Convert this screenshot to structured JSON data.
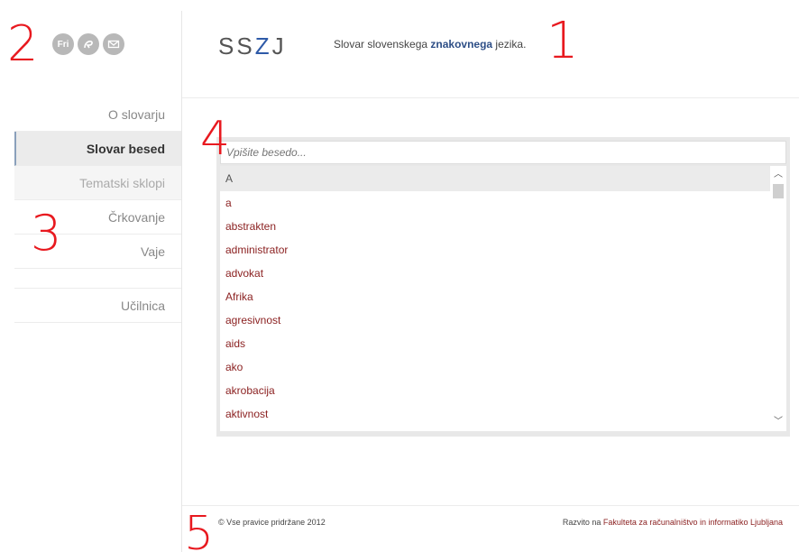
{
  "annotations": [
    "1",
    "2",
    "3",
    "4",
    "5"
  ],
  "header": {
    "logo_prefix": "SS",
    "logo_z": "Z",
    "logo_suffix": "J",
    "tagline_pre": "Slovar slovenskega ",
    "tagline_bold": "znakovnega",
    "tagline_post": " jezika."
  },
  "social_icons": [
    {
      "name": "fri-icon",
      "label": "Fri"
    },
    {
      "name": "sign-language-icon"
    },
    {
      "name": "mail-icon"
    }
  ],
  "nav": {
    "items": [
      {
        "label": "O slovarju"
      },
      {
        "label": "Slovar besed",
        "state": "active"
      },
      {
        "label": "Tematski sklopi"
      },
      {
        "label": "Črkovanje"
      },
      {
        "label": "Vaje"
      },
      {
        "label": "Učilnica"
      }
    ]
  },
  "dictionary": {
    "search_placeholder": "Vpišite besedo...",
    "letter": "A",
    "words": [
      "a",
      "abstrakten",
      "administrator",
      "advokat",
      "Afrika",
      "agresivnost",
      "aids",
      "ako",
      "akrobacija",
      "aktivnost"
    ]
  },
  "footer": {
    "copyright": "© Vse pravice pridržane 2012",
    "developed_pre": "Razvito na ",
    "developed_link": "Fakulteta za računalništvo in informatiko Ljubljana"
  },
  "colors": {
    "accent_blue": "#2e5aa8",
    "word_red": "#8a1f1f",
    "annotation_red": "#e8191f"
  }
}
